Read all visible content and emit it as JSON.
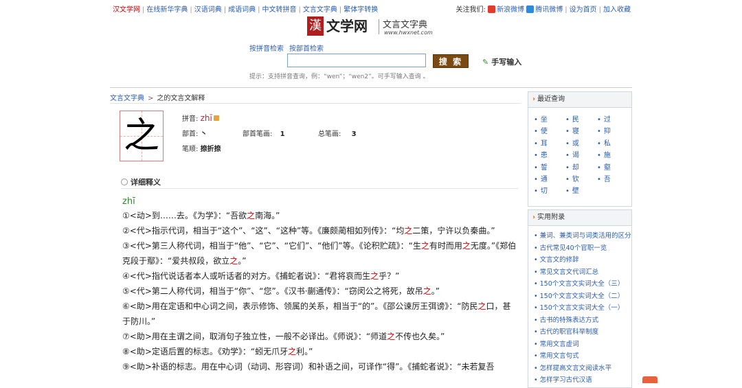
{
  "topbar": {
    "links": [
      "汉文学网",
      "在线新华字典",
      "汉语词典",
      "成语词典",
      "中文转拼音",
      "文言文字典",
      "繁体字转换"
    ],
    "follow_label": "关注我们:",
    "weibo": "新浪微博",
    "tweibo": "腾讯微博",
    "set_home": "设为首页",
    "favorite": "加入收藏"
  },
  "logo": {
    "seal": "漢",
    "brand": "文学网",
    "subtitle": "文言文字典",
    "url": "www.hwxnet.com"
  },
  "search": {
    "mode_pinyin": "按拼音检索",
    "mode_radical": "按部首检索",
    "button": "搜 索",
    "handwrite": "手写输入",
    "hint": "提示：支持拼音查询，例：“wen”；“wen2”。可手写输入查询 。"
  },
  "breadcrumb": {
    "root": "文言文字典",
    "current": "之的文言文解释"
  },
  "char": {
    "glyph": "之",
    "pinyin_label": "拼音:",
    "pinyin": "zhī",
    "radical_label": "部首:",
    "radical": "丶",
    "radical_strokes_label": "部首笔画:",
    "radical_strokes": "1",
    "total_strokes_label": "总笔画:",
    "total_strokes": "3",
    "stroke_order_label": "笔顺:",
    "stroke_order": "捺折捺"
  },
  "details": {
    "title": "详细释义",
    "pinyin": "zhī",
    "defs": [
      [
        "①<动>到……去。《为学》：“吾欲",
        "之",
        "南海。”"
      ],
      [
        "②<代>指示代词，相当于“这个”、“这”、“这种”等。《廉颇蔺相如列传》：“均",
        "之",
        "二策，宁许以负秦曲。”"
      ],
      [
        "③<代>第三人称代词，相当于“他”、“它”、“它们”、“他们”等。《论积贮疏》：“生",
        "之",
        "有时而用",
        "之",
        "无度。”《郑伯克段于鄢》：“爱共叔段，欲立",
        "之",
        "。”"
      ],
      [
        "④<代>指代说话者本人或听话者的对方。《捕蛇者说》：“君将哀而生",
        "之",
        "乎？”"
      ],
      [
        "⑤<代>第二人称代词，相当于“你”、“您”。《汉书·蒯通传》：“窃闵公之将死，故吊",
        "之",
        "。”"
      ],
      [
        "⑥<助>用在定语和中心词之间，表示修饰、领属的关系，相当于“的”。《邵公谏厉王弭谤》：“防民",
        "之",
        "口，甚于防川。”"
      ],
      [
        "⑦<助>用在主谓之间，取消句子独立性，一般不必译出。《师说》：“师道",
        "之",
        "不传也久矣。”"
      ],
      [
        "⑧<助>定语后置的标志。《劝学》：“蚓无爪牙",
        "之",
        "利。”"
      ],
      [
        "⑨<助>补语的标志。用在中心词（动词、形容词）和补语之间，可译作“得”。《捕蛇者说》：“未若复吾"
      ]
    ]
  },
  "recent": {
    "title": "最近查询",
    "items": [
      "坐",
      "民",
      "过",
      "使",
      "寝",
      "抑",
      "耳",
      "或",
      "私",
      "患",
      "谒",
      "施",
      "誓",
      "却",
      "壑",
      "通",
      "钦",
      "吾",
      "切",
      "壁"
    ]
  },
  "appendix": {
    "title": "实用附录",
    "items": [
      "兼词、兼类词与词类活用的区分",
      "古代常见40个官职一览",
      "文言文的修辞",
      "常见文言文代词汇总",
      "150个文言文实词大全（三）",
      "150个文言文实词大全（二）",
      "150个文言文实词大全（一）",
      "古书的特殊表达方式",
      "古代的职官科举制度",
      "常用文言虚词",
      "常用文言句式",
      "怎样提高文言文阅读水平",
      "怎样学习古代汉语"
    ]
  }
}
